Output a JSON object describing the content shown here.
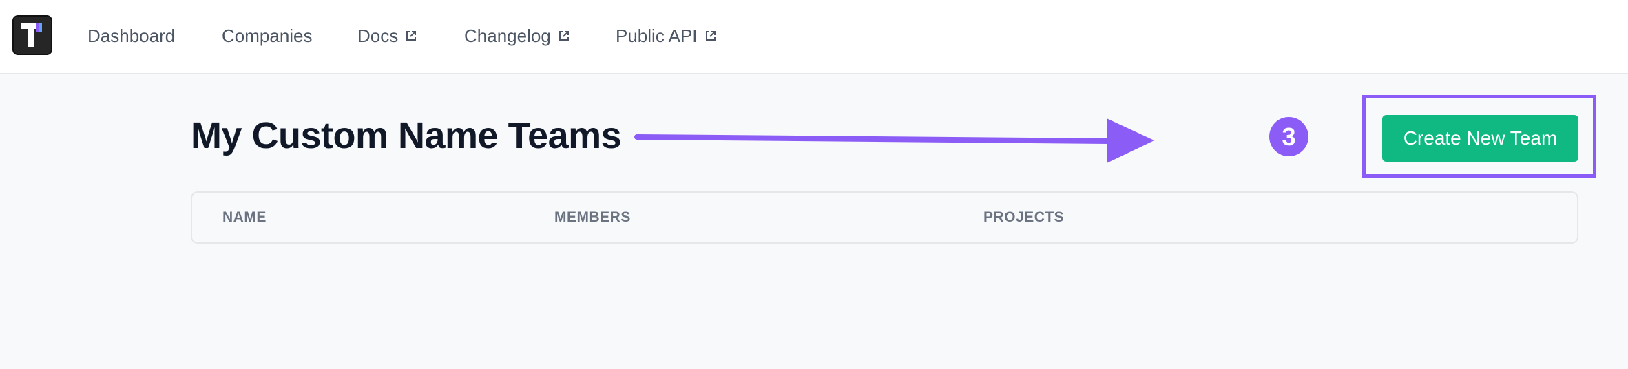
{
  "nav": {
    "items": [
      {
        "label": "Dashboard",
        "external": false
      },
      {
        "label": "Companies",
        "external": false
      },
      {
        "label": "Docs",
        "external": true
      },
      {
        "label": "Changelog",
        "external": true
      },
      {
        "label": "Public API",
        "external": true
      }
    ]
  },
  "main": {
    "title": "My Custom Name Teams",
    "create_button_label": "Create New Team",
    "step_number": "3",
    "table": {
      "columns": [
        "NAME",
        "MEMBERS",
        "PROJECTS"
      ]
    }
  },
  "colors": {
    "accent": "#8b5cf6",
    "primary_button": "#10b981",
    "logo_bg": "#262626"
  }
}
